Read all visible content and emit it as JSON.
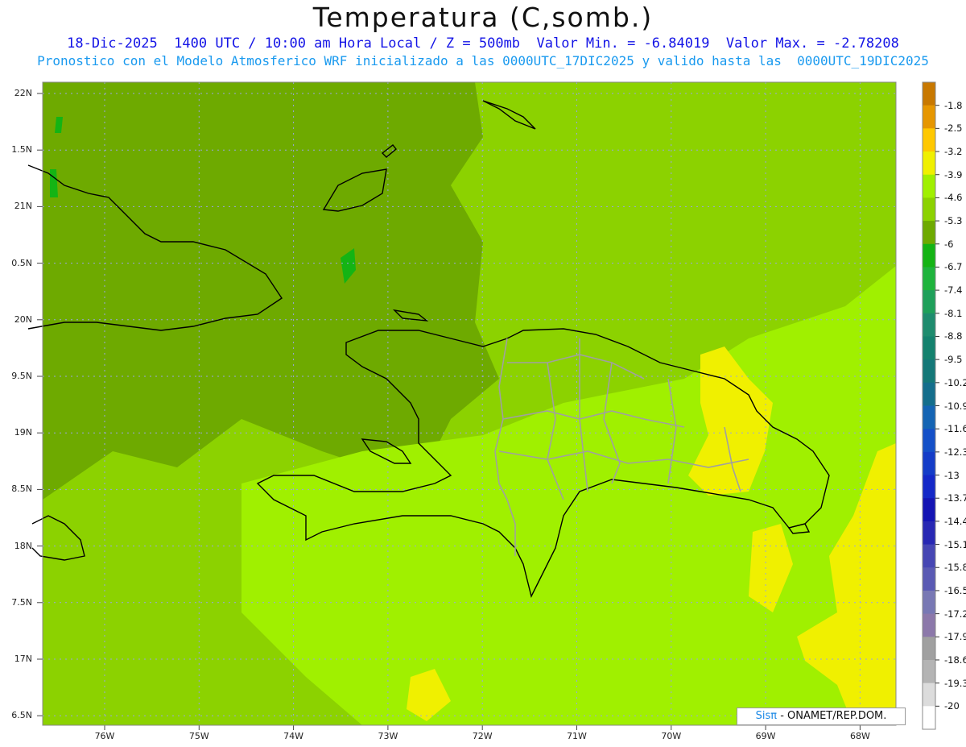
{
  "title": "Temperatura (C,somb.)",
  "subtitle1": "18-Dic-2025  1400 UTC / 10:00 am Hora Local / Z = 500mb  Valor Min. = -6.84019  Valor Max. = -2.78208",
  "subtitle2": "Pronostico con el Modelo Atmosferico WRF inicializado a las 0000UTC_17DIC2025 y valido hasta las  0000UTC_19DIC2025",
  "y_axis_labels": [
    "22N",
    "1.5N",
    "21N",
    "0.5N",
    "20N",
    "9.5N",
    "19N",
    "8.5N",
    "18N",
    "7.5N",
    "17N",
    "6.5N"
  ],
  "x_axis_labels": [
    "76W",
    "75W",
    "74W",
    "73W",
    "72W",
    "71W",
    "70W",
    "69W",
    "68W"
  ],
  "colorbar": {
    "labels": [
      "-1.8",
      "-2.5",
      "-3.2",
      "-3.9",
      "-4.6",
      "-5.3",
      "-6",
      "-6.7",
      "-7.4",
      "-8.1",
      "-8.8",
      "-9.5",
      "-10.2",
      "-10.9",
      "-11.6",
      "-12.3",
      "-13",
      "-13.7",
      "-14.4",
      "-15.1",
      "-15.8",
      "-16.5",
      "-17.2",
      "-17.9",
      "-18.6",
      "-19.3",
      "-20"
    ],
    "colors": [
      "#c87800",
      "#e69600",
      "#ffc800",
      "#f0f000",
      "#a0f000",
      "#8cd200",
      "#6eaa00",
      "#14b414",
      "#1eb43c",
      "#1ea05a",
      "#1e8c6e",
      "#14826e",
      "#147878",
      "#146e8c",
      "#1464b4",
      "#1450c8",
      "#143cc8",
      "#1428c8",
      "#1414b4",
      "#2828b4",
      "#4646b4",
      "#5a5ab4",
      "#7878b4",
      "#8c78aa",
      "#a0a0a0",
      "#b4b4b4",
      "#dcdcdc",
      "#ffffff"
    ]
  },
  "credit": {
    "sis": "Sisπ",
    "rest": " - ONAMET/REP.DOM."
  },
  "colors": {
    "field_dark": "#6eaa00",
    "field_mid": "#8cd200",
    "field_light": "#a0f000",
    "field_yellow": "#f0f000",
    "coast": "#000000",
    "provinces": "#a0a0a0"
  }
}
